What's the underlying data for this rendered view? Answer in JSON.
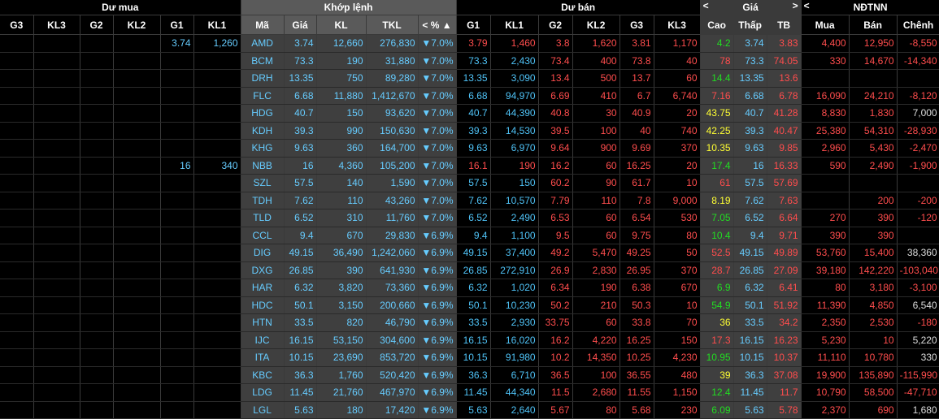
{
  "groups": {
    "du_mua": "Dư mua",
    "khop_lenh": "Khớp lệnh",
    "du_ban": "Dư bán",
    "gia": "Giá",
    "ndtnn": "NĐTNN"
  },
  "chevrons": {
    "left": "<",
    "right": ">",
    "sort_up": "▲"
  },
  "columns": {
    "g3": "G3",
    "kl3": "KL3",
    "g2": "G2",
    "kl2": "KL2",
    "g1": "G1",
    "kl1": "KL1",
    "ma": "Mã",
    "gia": "Giá",
    "kl": "KL",
    "tkl": "TKL",
    "pct": "%",
    "s_g1": "G1",
    "s_kl1": "KL1",
    "s_g2": "G2",
    "s_kl2": "KL2",
    "s_g3": "G3",
    "s_kl3": "KL3",
    "cao": "Cao",
    "thap": "Thấp",
    "tb": "TB",
    "mua": "Mua",
    "ban": "Bán",
    "chenh": "Chênh"
  },
  "colors": {
    "ceiling": "#66ccff",
    "down": "#ff4d4d",
    "up": "#22dd22",
    "up_strong": "#ffff33",
    "neutral": "#dddddd"
  },
  "rows": [
    {
      "b_g1": "3.74",
      "b_kl1": "1,260",
      "ma": "AMD",
      "gia": "3.74",
      "kl": "12,660",
      "tkl": "276,830",
      "pct": "▼7.0%",
      "s_g1": "3.79",
      "s_g1_c": "r",
      "s_kl1": "1,460",
      "s_kl1_c": "r",
      "s_g2": "3.8",
      "s_g2_c": "r",
      "s_kl2": "1,620",
      "s_kl2_c": "r",
      "s_g3": "3.81",
      "s_g3_c": "r",
      "s_kl3": "1,170",
      "s_kl3_c": "r",
      "cao": "4.2",
      "cao_c": "g",
      "thap": "3.74",
      "tb": "3.83",
      "tb_c": "r",
      "mua": "4,400",
      "ban": "12,950",
      "chenh": "-8,550"
    },
    {
      "ma": "BCM",
      "gia": "73.3",
      "kl": "190",
      "tkl": "31,880",
      "pct": "▼7.0%",
      "s_g1": "73.3",
      "s_g1_c": "c",
      "s_kl1": "2,430",
      "s_kl1_c": "c",
      "s_g2": "73.4",
      "s_g2_c": "r",
      "s_kl2": "400",
      "s_kl2_c": "r",
      "s_g3": "73.8",
      "s_g3_c": "r",
      "s_kl3": "40",
      "s_kl3_c": "r",
      "cao": "78",
      "cao_c": "r",
      "thap": "73.3",
      "tb": "74.05",
      "tb_c": "r",
      "mua": "330",
      "ban": "14,670",
      "chenh": "-14,340"
    },
    {
      "ma": "DRH",
      "gia": "13.35",
      "kl": "750",
      "tkl": "89,280",
      "pct": "▼7.0%",
      "s_g1": "13.35",
      "s_g1_c": "c",
      "s_kl1": "3,090",
      "s_kl1_c": "c",
      "s_g2": "13.4",
      "s_g2_c": "r",
      "s_kl2": "500",
      "s_kl2_c": "r",
      "s_g3": "13.7",
      "s_g3_c": "r",
      "s_kl3": "60",
      "s_kl3_c": "r",
      "cao": "14.4",
      "cao_c": "g",
      "thap": "13.35",
      "tb": "13.6",
      "tb_c": "r",
      "mua": "",
      "ban": "",
      "chenh": ""
    },
    {
      "ma": "FLC",
      "gia": "6.68",
      "kl": "11,880",
      "tkl": "1,412,670",
      "pct": "▼7.0%",
      "s_g1": "6.68",
      "s_g1_c": "c",
      "s_kl1": "94,970",
      "s_kl1_c": "c",
      "s_g2": "6.69",
      "s_g2_c": "r",
      "s_kl2": "410",
      "s_kl2_c": "r",
      "s_g3": "6.7",
      "s_g3_c": "r",
      "s_kl3": "6,740",
      "s_kl3_c": "r",
      "cao": "7.16",
      "cao_c": "r",
      "thap": "6.68",
      "tb": "6.78",
      "tb_c": "r",
      "mua": "16,090",
      "ban": "24,210",
      "chenh": "-8,120"
    },
    {
      "ma": "HDG",
      "gia": "40.7",
      "kl": "150",
      "tkl": "93,620",
      "pct": "▼7.0%",
      "s_g1": "40.7",
      "s_g1_c": "c",
      "s_kl1": "44,390",
      "s_kl1_c": "c",
      "s_g2": "40.8",
      "s_g2_c": "r",
      "s_kl2": "30",
      "s_kl2_c": "r",
      "s_g3": "40.9",
      "s_g3_c": "r",
      "s_kl3": "20",
      "s_kl3_c": "r",
      "cao": "43.75",
      "cao_c": "y",
      "thap": "40.7",
      "tb": "41.28",
      "tb_c": "r",
      "mua": "8,830",
      "ban": "1,830",
      "chenh": "7,000"
    },
    {
      "ma": "KDH",
      "gia": "39.3",
      "kl": "990",
      "tkl": "150,630",
      "pct": "▼7.0%",
      "s_g1": "39.3",
      "s_g1_c": "c",
      "s_kl1": "14,530",
      "s_kl1_c": "c",
      "s_g2": "39.5",
      "s_g2_c": "r",
      "s_kl2": "100",
      "s_kl2_c": "r",
      "s_g3": "40",
      "s_g3_c": "r",
      "s_kl3": "740",
      "s_kl3_c": "r",
      "cao": "42.25",
      "cao_c": "y",
      "thap": "39.3",
      "tb": "40.47",
      "tb_c": "r",
      "mua": "25,380",
      "ban": "54,310",
      "chenh": "-28,930"
    },
    {
      "ma": "KHG",
      "gia": "9.63",
      "kl": "360",
      "tkl": "164,700",
      "pct": "▼7.0%",
      "s_g1": "9.63",
      "s_g1_c": "c",
      "s_kl1": "6,970",
      "s_kl1_c": "c",
      "s_g2": "9.64",
      "s_g2_c": "r",
      "s_kl2": "900",
      "s_kl2_c": "r",
      "s_g3": "9.69",
      "s_g3_c": "r",
      "s_kl3": "370",
      "s_kl3_c": "r",
      "cao": "10.35",
      "cao_c": "y",
      "thap": "9.63",
      "tb": "9.85",
      "tb_c": "r",
      "mua": "2,960",
      "ban": "5,430",
      "chenh": "-2,470"
    },
    {
      "b_g1": "16",
      "b_kl1": "340",
      "ma": "NBB",
      "gia": "16",
      "kl": "4,360",
      "tkl": "105,200",
      "pct": "▼7.0%",
      "s_g1": "16.1",
      "s_g1_c": "r",
      "s_kl1": "190",
      "s_kl1_c": "r",
      "s_g2": "16.2",
      "s_g2_c": "r",
      "s_kl2": "60",
      "s_kl2_c": "r",
      "s_g3": "16.25",
      "s_g3_c": "r",
      "s_kl3": "20",
      "s_kl3_c": "r",
      "cao": "17.4",
      "cao_c": "g",
      "thap": "16",
      "tb": "16.33",
      "tb_c": "r",
      "mua": "590",
      "ban": "2,490",
      "chenh": "-1,900"
    },
    {
      "ma": "SZL",
      "gia": "57.5",
      "kl": "140",
      "tkl": "1,590",
      "pct": "▼7.0%",
      "s_g1": "57.5",
      "s_g1_c": "c",
      "s_kl1": "150",
      "s_kl1_c": "c",
      "s_g2": "60.2",
      "s_g2_c": "r",
      "s_kl2": "90",
      "s_kl2_c": "r",
      "s_g3": "61.7",
      "s_g3_c": "r",
      "s_kl3": "10",
      "s_kl3_c": "r",
      "cao": "61",
      "cao_c": "r",
      "thap": "57.5",
      "tb": "57.69",
      "tb_c": "r",
      "mua": "",
      "ban": "",
      "chenh": ""
    },
    {
      "ma": "TDH",
      "gia": "7.62",
      "kl": "110",
      "tkl": "43,260",
      "pct": "▼7.0%",
      "s_g1": "7.62",
      "s_g1_c": "c",
      "s_kl1": "10,570",
      "s_kl1_c": "c",
      "s_g2": "7.79",
      "s_g2_c": "r",
      "s_kl2": "110",
      "s_kl2_c": "r",
      "s_g3": "7.8",
      "s_g3_c": "r",
      "s_kl3": "9,000",
      "s_kl3_c": "r",
      "cao": "8.19",
      "cao_c": "y",
      "thap": "7.62",
      "tb": "7.63",
      "tb_c": "r",
      "mua": "",
      "ban": "200",
      "chenh": "-200"
    },
    {
      "ma": "TLD",
      "gia": "6.52",
      "kl": "310",
      "tkl": "11,760",
      "pct": "▼7.0%",
      "s_g1": "6.52",
      "s_g1_c": "c",
      "s_kl1": "2,490",
      "s_kl1_c": "c",
      "s_g2": "6.53",
      "s_g2_c": "r",
      "s_kl2": "60",
      "s_kl2_c": "r",
      "s_g3": "6.54",
      "s_g3_c": "r",
      "s_kl3": "530",
      "s_kl3_c": "r",
      "cao": "7.05",
      "cao_c": "g",
      "thap": "6.52",
      "tb": "6.64",
      "tb_c": "r",
      "mua": "270",
      "ban": "390",
      "chenh": "-120"
    },
    {
      "ma": "CCL",
      "gia": "9.4",
      "kl": "670",
      "tkl": "29,830",
      "pct": "▼6.9%",
      "s_g1": "9.4",
      "s_g1_c": "c",
      "s_kl1": "1,100",
      "s_kl1_c": "c",
      "s_g2": "9.5",
      "s_g2_c": "r",
      "s_kl2": "60",
      "s_kl2_c": "r",
      "s_g3": "9.75",
      "s_g3_c": "r",
      "s_kl3": "80",
      "s_kl3_c": "r",
      "cao": "10.4",
      "cao_c": "g",
      "thap": "9.4",
      "tb": "9.71",
      "tb_c": "r",
      "mua": "390",
      "ban": "390",
      "chenh": ""
    },
    {
      "ma": "DIG",
      "gia": "49.15",
      "kl": "36,490",
      "tkl": "1,242,060",
      "pct": "▼6.9%",
      "s_g1": "49.15",
      "s_g1_c": "c",
      "s_kl1": "37,400",
      "s_kl1_c": "c",
      "s_g2": "49.2",
      "s_g2_c": "r",
      "s_kl2": "5,470",
      "s_kl2_c": "r",
      "s_g3": "49.25",
      "s_g3_c": "r",
      "s_kl3": "50",
      "s_kl3_c": "r",
      "cao": "52.5",
      "cao_c": "r",
      "thap": "49.15",
      "tb": "49.89",
      "tb_c": "r",
      "mua": "53,760",
      "ban": "15,400",
      "chenh": "38,360"
    },
    {
      "ma": "DXG",
      "gia": "26.85",
      "kl": "390",
      "tkl": "641,930",
      "pct": "▼6.9%",
      "s_g1": "26.85",
      "s_g1_c": "c",
      "s_kl1": "272,910",
      "s_kl1_c": "c",
      "s_g2": "26.9",
      "s_g2_c": "r",
      "s_kl2": "2,830",
      "s_kl2_c": "r",
      "s_g3": "26.95",
      "s_g3_c": "r",
      "s_kl3": "370",
      "s_kl3_c": "r",
      "cao": "28.7",
      "cao_c": "r",
      "thap": "26.85",
      "tb": "27.09",
      "tb_c": "r",
      "mua": "39,180",
      "ban": "142,220",
      "chenh": "-103,040"
    },
    {
      "ma": "HAR",
      "gia": "6.32",
      "kl": "3,820",
      "tkl": "73,360",
      "pct": "▼6.9%",
      "s_g1": "6.32",
      "s_g1_c": "c",
      "s_kl1": "1,020",
      "s_kl1_c": "c",
      "s_g2": "6.34",
      "s_g2_c": "r",
      "s_kl2": "190",
      "s_kl2_c": "r",
      "s_g3": "6.38",
      "s_g3_c": "r",
      "s_kl3": "670",
      "s_kl3_c": "r",
      "cao": "6.9",
      "cao_c": "g",
      "thap": "6.32",
      "tb": "6.41",
      "tb_c": "r",
      "mua": "80",
      "ban": "3,180",
      "chenh": "-3,100"
    },
    {
      "ma": "HDC",
      "gia": "50.1",
      "kl": "3,150",
      "tkl": "200,660",
      "pct": "▼6.9%",
      "s_g1": "50.1",
      "s_g1_c": "c",
      "s_kl1": "10,230",
      "s_kl1_c": "c",
      "s_g2": "50.2",
      "s_g2_c": "r",
      "s_kl2": "210",
      "s_kl2_c": "r",
      "s_g3": "50.3",
      "s_g3_c": "r",
      "s_kl3": "10",
      "s_kl3_c": "r",
      "cao": "54.9",
      "cao_c": "g",
      "thap": "50.1",
      "tb": "51.92",
      "tb_c": "r",
      "mua": "11,390",
      "ban": "4,850",
      "chenh": "6,540"
    },
    {
      "ma": "HTN",
      "gia": "33.5",
      "kl": "820",
      "tkl": "46,790",
      "pct": "▼6.9%",
      "s_g1": "33.5",
      "s_g1_c": "c",
      "s_kl1": "2,930",
      "s_kl1_c": "c",
      "s_g2": "33.75",
      "s_g2_c": "r",
      "s_kl2": "60",
      "s_kl2_c": "r",
      "s_g3": "33.8",
      "s_g3_c": "r",
      "s_kl3": "70",
      "s_kl3_c": "r",
      "cao": "36",
      "cao_c": "y",
      "thap": "33.5",
      "tb": "34.2",
      "tb_c": "r",
      "mua": "2,350",
      "ban": "2,530",
      "chenh": "-180"
    },
    {
      "ma": "IJC",
      "gia": "16.15",
      "kl": "53,150",
      "tkl": "304,600",
      "pct": "▼6.9%",
      "s_g1": "16.15",
      "s_g1_c": "c",
      "s_kl1": "16,020",
      "s_kl1_c": "c",
      "s_g2": "16.2",
      "s_g2_c": "r",
      "s_kl2": "4,220",
      "s_kl2_c": "r",
      "s_g3": "16.25",
      "s_g3_c": "r",
      "s_kl3": "150",
      "s_kl3_c": "r",
      "cao": "17.3",
      "cao_c": "r",
      "thap": "16.15",
      "tb": "16.23",
      "tb_c": "r",
      "mua": "5,230",
      "ban": "10",
      "chenh": "5,220"
    },
    {
      "ma": "ITA",
      "gia": "10.15",
      "kl": "23,690",
      "tkl": "853,720",
      "pct": "▼6.9%",
      "s_g1": "10.15",
      "s_g1_c": "c",
      "s_kl1": "91,980",
      "s_kl1_c": "c",
      "s_g2": "10.2",
      "s_g2_c": "r",
      "s_kl2": "14,350",
      "s_kl2_c": "r",
      "s_g3": "10.25",
      "s_g3_c": "r",
      "s_kl3": "4,230",
      "s_kl3_c": "r",
      "cao": "10.95",
      "cao_c": "g",
      "thap": "10.15",
      "tb": "10.37",
      "tb_c": "r",
      "mua": "11,110",
      "ban": "10,780",
      "chenh": "330"
    },
    {
      "ma": "KBC",
      "gia": "36.3",
      "kl": "1,760",
      "tkl": "520,420",
      "pct": "▼6.9%",
      "s_g1": "36.3",
      "s_g1_c": "c",
      "s_kl1": "6,710",
      "s_kl1_c": "c",
      "s_g2": "36.5",
      "s_g2_c": "r",
      "s_kl2": "100",
      "s_kl2_c": "r",
      "s_g3": "36.55",
      "s_g3_c": "r",
      "s_kl3": "480",
      "s_kl3_c": "r",
      "cao": "39",
      "cao_c": "y",
      "thap": "36.3",
      "tb": "37.08",
      "tb_c": "r",
      "mua": "19,900",
      "ban": "135,890",
      "chenh": "-115,990"
    },
    {
      "ma": "LDG",
      "gia": "11.45",
      "kl": "21,760",
      "tkl": "467,970",
      "pct": "▼6.9%",
      "s_g1": "11.45",
      "s_g1_c": "c",
      "s_kl1": "44,340",
      "s_kl1_c": "c",
      "s_g2": "11.5",
      "s_g2_c": "r",
      "s_kl2": "2,680",
      "s_kl2_c": "r",
      "s_g3": "11.55",
      "s_g3_c": "r",
      "s_kl3": "1,150",
      "s_kl3_c": "r",
      "cao": "12.4",
      "cao_c": "g",
      "thap": "11.45",
      "tb": "11.7",
      "tb_c": "r",
      "mua": "10,790",
      "ban": "58,500",
      "chenh": "-47,710"
    },
    {
      "ma": "LGL",
      "gia": "5.63",
      "kl": "180",
      "tkl": "17,420",
      "pct": "▼6.9%",
      "s_g1": "5.63",
      "s_g1_c": "c",
      "s_kl1": "2,640",
      "s_kl1_c": "c",
      "s_g2": "5.67",
      "s_g2_c": "r",
      "s_kl2": "80",
      "s_kl2_c": "r",
      "s_g3": "5.68",
      "s_g3_c": "r",
      "s_kl3": "230",
      "s_kl3_c": "r",
      "cao": "6.09",
      "cao_c": "g",
      "thap": "5.63",
      "tb": "5.78",
      "tb_c": "r",
      "mua": "2,370",
      "ban": "690",
      "chenh": "1,680"
    }
  ]
}
